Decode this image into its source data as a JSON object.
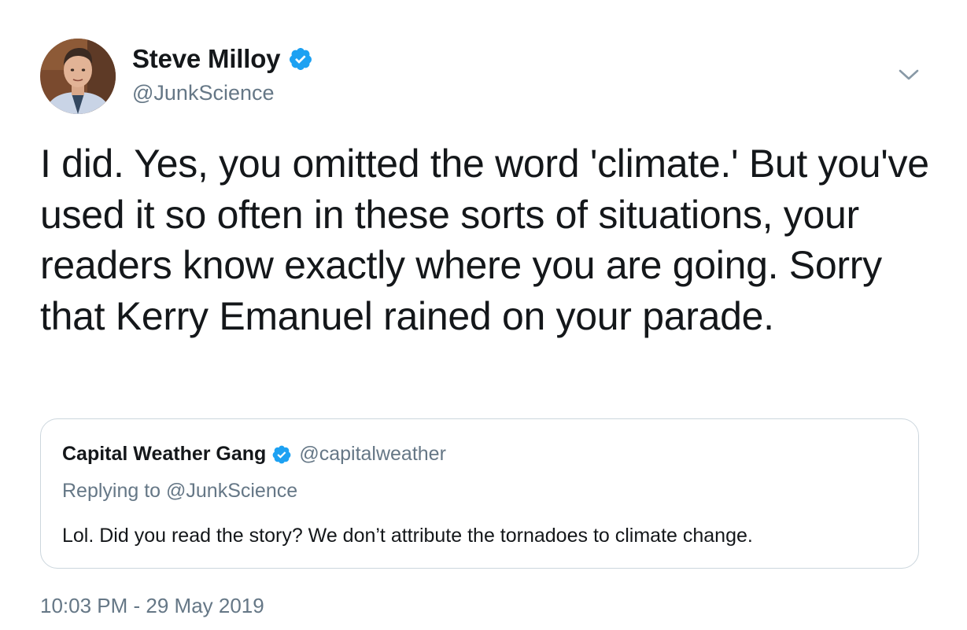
{
  "author": {
    "name": "Steve Milloy",
    "handle": "@JunkScience",
    "verified": true,
    "avatar_icon": "profile-photo"
  },
  "tweet": {
    "text": "I did. Yes, you omitted the word 'climate.' But you've used it so often in these sorts of situations, your readers know exactly where you are going. Sorry that Kerry Emanuel rained on your parade.",
    "timestamp": "10:03 PM - 29 May 2019"
  },
  "quoted_tweet": {
    "name": "Capital Weather Gang",
    "handle": "@capitalweather",
    "verified": true,
    "replying_to": "Replying to @JunkScience",
    "text": "Lol. Did you read the story? We don’t attribute the tornadoes to climate change."
  },
  "icons": {
    "verified": "verified-badge-icon",
    "menu": "chevron-down-icon"
  },
  "colors": {
    "text_primary": "#14171a",
    "text_secondary": "#657786",
    "verified_blue": "#1da1f2",
    "border": "#ccd6dd"
  }
}
